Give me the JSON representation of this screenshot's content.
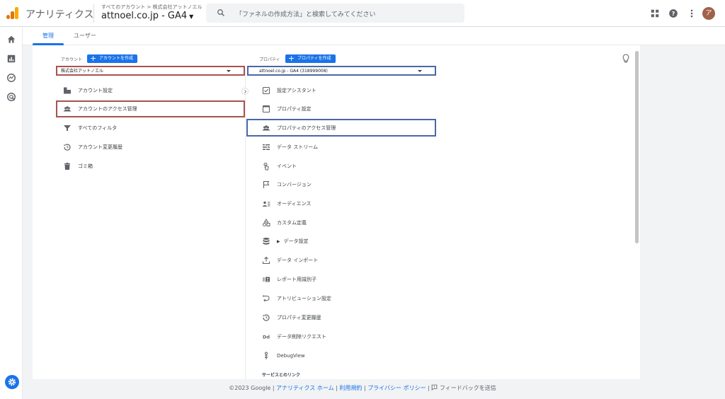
{
  "header": {
    "app_name": "アナリティクス",
    "breadcrumb": "すべてのアカウント > 株式会社アットノエル",
    "property_title": "attnoel.co.jp - GA4",
    "search_placeholder": "「ファネルの作成方法」と検索してみてください",
    "avatar_letter": "ア"
  },
  "tabs": [
    {
      "label": "管理"
    },
    {
      "label": "ユーザー"
    }
  ],
  "account_column": {
    "label": "アカウント",
    "create_button": "アカウントを作成",
    "selected": "株式会社アットノエル",
    "items": [
      {
        "label": "アカウント設定",
        "icon": "building-icon"
      },
      {
        "label": "アカウントのアクセス管理",
        "icon": "people-icon"
      },
      {
        "label": "すべてのフィルタ",
        "icon": "filter-icon"
      },
      {
        "label": "アカウント変更履歴",
        "icon": "history-icon"
      },
      {
        "label": "ゴミ箱",
        "icon": "trash-icon"
      }
    ]
  },
  "property_column": {
    "label": "プロパティ",
    "create_button": "プロパティを作成",
    "selected": "attnoel.co.jp - GA4 (318999008)",
    "items": [
      {
        "label": "設定アシスタント",
        "icon": "checkbox-icon"
      },
      {
        "label": "プロパティ設定",
        "icon": "window-icon"
      },
      {
        "label": "プロパティのアクセス管理",
        "icon": "people-icon"
      },
      {
        "label": "データ ストリーム",
        "icon": "stream-icon"
      },
      {
        "label": "イベント",
        "icon": "touch-icon"
      },
      {
        "label": "コンバージョン",
        "icon": "flag-icon"
      },
      {
        "label": "オーディエンス",
        "icon": "audience-icon"
      },
      {
        "label": "カスタム定義",
        "icon": "shapes-icon"
      },
      {
        "label": "データ設定",
        "icon": "database-icon"
      },
      {
        "label": "データ インポート",
        "icon": "upload-icon"
      },
      {
        "label": "レポート用識別子",
        "icon": "id-icon"
      },
      {
        "label": "アトリビューション設定",
        "icon": "attribution-icon"
      },
      {
        "label": "プロパティ変更履歴",
        "icon": "history-icon"
      },
      {
        "label": "データ削除リクエスト",
        "icon": "dd-icon"
      },
      {
        "label": "DebugView",
        "icon": "debug-icon"
      }
    ],
    "section_links": "サービスとのリンク"
  },
  "footer": {
    "copyright": "©2023 Google",
    "links": [
      "アナリティクス ホーム",
      "利用規約",
      "プライバシー ポリシー"
    ],
    "feedback": "フィードバックを送信",
    "sep": "|"
  },
  "colors": {
    "accent": "#1a73e8",
    "highlight_account": "#a8534f",
    "highlight_property": "#4a66a8",
    "logo": "#f9ab00"
  }
}
